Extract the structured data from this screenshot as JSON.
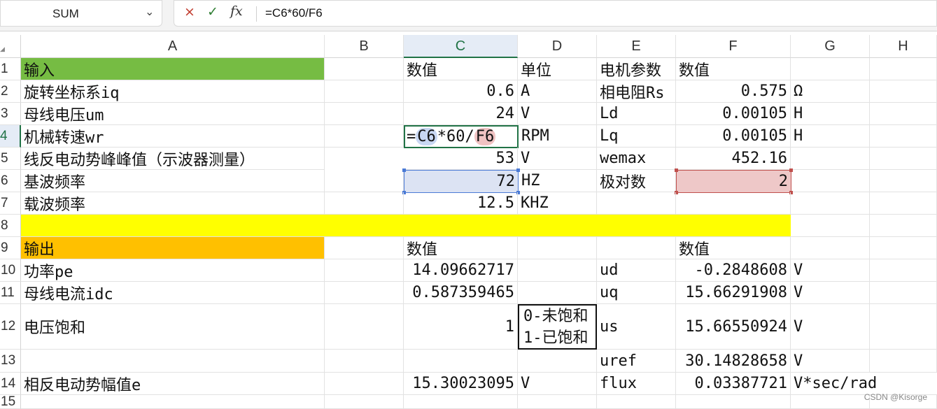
{
  "name_box": {
    "value": "SUM"
  },
  "formula_bar": {
    "cancel_icon": "×",
    "enter_icon": "✓",
    "function_label": "fx",
    "formula": "=C6*60/F6"
  },
  "columns": [
    "A",
    "B",
    "C",
    "D",
    "E",
    "F",
    "G",
    "H"
  ],
  "rows": [
    "1",
    "2",
    "3",
    "4",
    "5",
    "6",
    "7",
    "8",
    "9",
    "10",
    "11",
    "12",
    "13",
    "14",
    "15"
  ],
  "selection": {
    "column": "C",
    "row": "4",
    "editing_cell": "C4",
    "referenced": [
      "C6",
      "F6"
    ]
  },
  "fills": {
    "input_header": "#76bc43",
    "divider_row": "#ffff00",
    "output_header": "#ffc000",
    "ref_c6": "#dce3f3",
    "ref_f6": "#eec8c8",
    "accent": "#217346"
  },
  "cells": {
    "A1": "输入",
    "C1": "数值",
    "D1": "单位",
    "E1": "电机参数",
    "F1": "数值",
    "A2": "旋转坐标系iq",
    "C2": "0.6",
    "D2": "A",
    "E2": "相电阻Rs",
    "F2": "0.575",
    "G2": "Ω",
    "A3": "母线电压um",
    "C3": "24",
    "D3": "V",
    "E3": "Ld",
    "F3": "0.00105",
    "G3": "H",
    "A4": "机械转速wr",
    "C4_eq": "=",
    "C4_ref1": "C6",
    "C4_mid": "*60/",
    "C4_ref2": "F6",
    "D4": "RPM",
    "E4": "Lq",
    "F4": "0.00105",
    "G4": "H",
    "A5": "线反电动势峰峰值（示波器测量）",
    "C5": "53",
    "D5": "V",
    "E5": "wemax",
    "F5": "452.16",
    "A6": "基波频率",
    "C6": "72",
    "D6": "HZ",
    "E6": "极对数",
    "F6": "2",
    "A7": "载波频率",
    "C7": "12.5",
    "D7": "KHZ",
    "A9": "输出",
    "C9": "数值",
    "F9": "数值",
    "A10": "功率pe",
    "C10": "14.09662717",
    "E10": "ud",
    "F10": "-0.2848608",
    "G10": "V",
    "A11": "母线电流idc",
    "C11": "0.587359465",
    "E11": "uq",
    "F11": "15.66291908",
    "G11": "V",
    "A12": "电压饱和",
    "C12": "1",
    "D12_line1": "0-未饱和",
    "D12_line2": "1-已饱和",
    "E12": "us",
    "F12": "15.66550924",
    "G12": "V",
    "E13": "uref",
    "F13": "30.14828658",
    "G13": "V",
    "A14": "相反电动势幅值e",
    "C14": "15.30023095",
    "D14": "V",
    "E14": "flux",
    "F14": "0.03387721",
    "G14": "V*sec/rad"
  },
  "watermark": "CSDN @Kisorge"
}
